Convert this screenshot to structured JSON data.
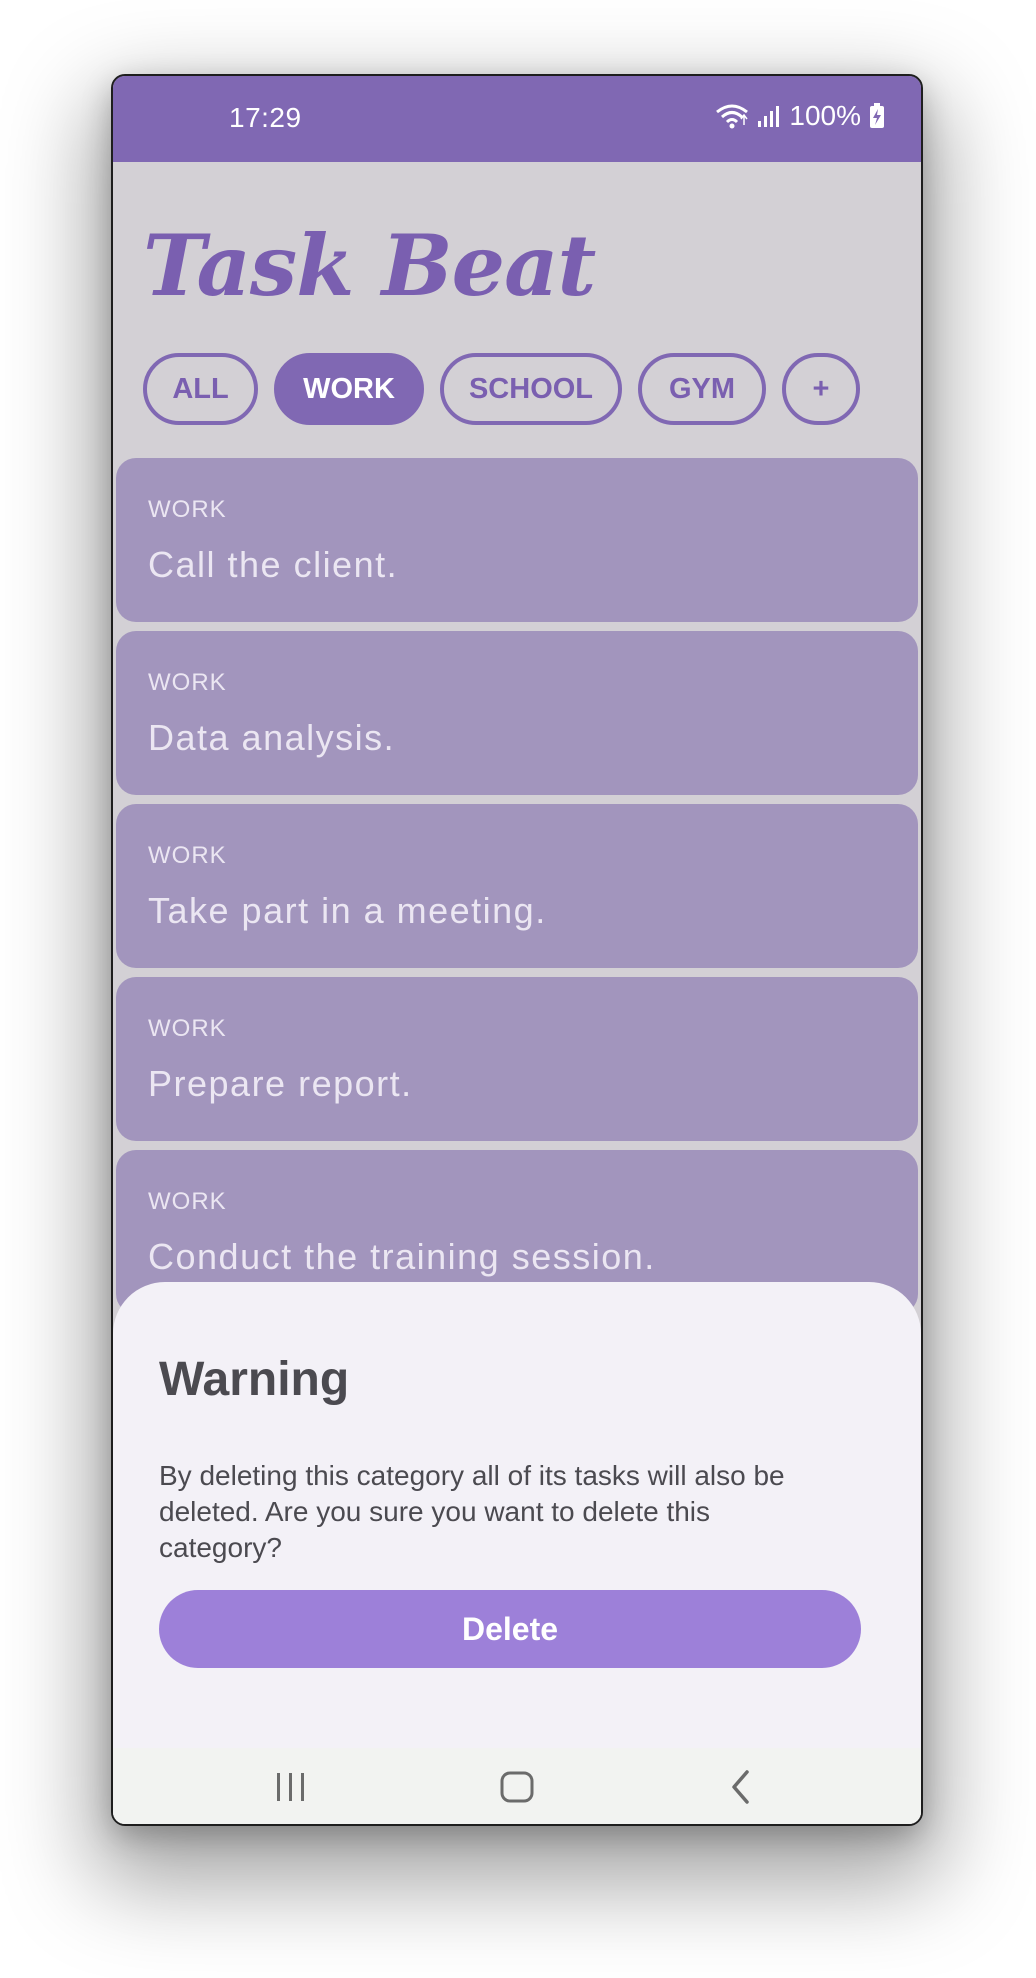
{
  "status_bar": {
    "time": "17:29",
    "battery": "100%",
    "icons": [
      "wifi-icon",
      "signal-icon",
      "battery-charging-icon"
    ]
  },
  "app": {
    "title": "Task Beat"
  },
  "categories": [
    {
      "label": "ALL",
      "active": false
    },
    {
      "label": "WORK",
      "active": true
    },
    {
      "label": "SCHOOL",
      "active": false
    },
    {
      "label": "GYM",
      "active": false
    },
    {
      "label": "+",
      "active": false
    }
  ],
  "tasks": [
    {
      "category": "WORK",
      "title": "Call the client."
    },
    {
      "category": "WORK",
      "title": "Data analysis."
    },
    {
      "category": "WORK",
      "title": "Take part in a meeting."
    },
    {
      "category": "WORK",
      "title": "Prepare report."
    },
    {
      "category": "WORK",
      "title": "Conduct the training session."
    }
  ],
  "dialog": {
    "title": "Warning",
    "message": "By deleting this category all of its tasks will also be deleted. Are you sure you want to delete this category?",
    "delete_label": "Delete"
  },
  "navigation": {
    "buttons": [
      "recent-apps-icon",
      "home-icon",
      "back-icon"
    ]
  },
  "colors": {
    "accent": "#8068b3",
    "card": "#a295bd",
    "sheet": "#f3f1f7",
    "delete_button": "#9d80d9"
  }
}
